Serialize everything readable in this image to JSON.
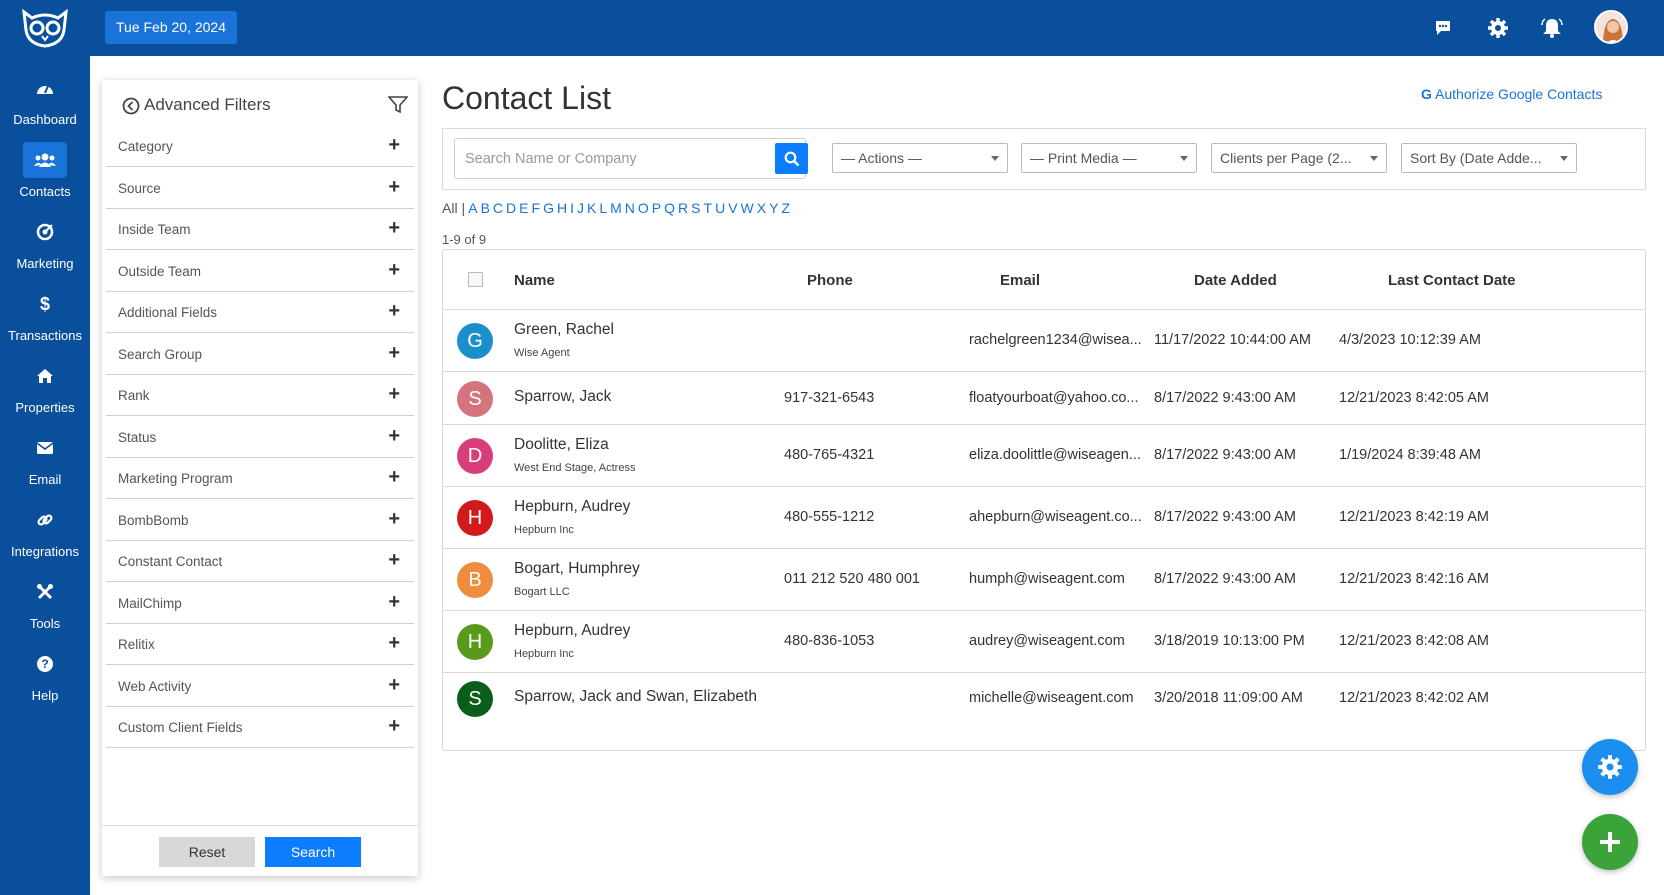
{
  "header": {
    "date": "Tue Feb 20, 2024",
    "icons": [
      "chat-icon",
      "gear-icon",
      "bell-icon",
      "avatar"
    ]
  },
  "sidebar": {
    "items": [
      {
        "label": "Dashboard",
        "icon": "speedometer-icon"
      },
      {
        "label": "Contacts",
        "icon": "users-icon",
        "active": true
      },
      {
        "label": "Marketing",
        "icon": "target-icon"
      },
      {
        "label": "Transactions",
        "icon": "dollar-icon"
      },
      {
        "label": "Properties",
        "icon": "home-icon"
      },
      {
        "label": "Email",
        "icon": "envelope-icon"
      },
      {
        "label": "Integrations",
        "icon": "link-icon"
      },
      {
        "label": "Tools",
        "icon": "tools-icon"
      },
      {
        "label": "Help",
        "icon": "question-icon"
      }
    ]
  },
  "filters": {
    "title": "Advanced Filters",
    "items": [
      "Category",
      "Source",
      "Inside Team",
      "Outside Team",
      "Additional Fields",
      "Search Group",
      "Rank",
      "Status",
      "Marketing Program",
      "BombBomb",
      "Constant Contact",
      "MailChimp",
      "Relitix",
      "Web Activity",
      "Custom Client Fields"
    ],
    "reset_label": "Reset",
    "search_label": "Search"
  },
  "main": {
    "title": "Contact List",
    "google_link": "Authorize Google Contacts",
    "search_placeholder": "Search Name or Company",
    "dropdowns": [
      "— Actions —",
      "— Print Media —",
      "Clients per Page (2...",
      "Sort By (Date Adde..."
    ],
    "alpha_all": "All",
    "alpha_letters": [
      "A",
      "B",
      "C",
      "D",
      "E",
      "F",
      "G",
      "H",
      "I",
      "J",
      "K",
      "L",
      "M",
      "N",
      "O",
      "P",
      "Q",
      "R",
      "S",
      "T",
      "U",
      "V",
      "W",
      "X",
      "Y",
      "Z"
    ],
    "count": "1-9 of 9",
    "columns": [
      "Name",
      "Phone",
      "Email",
      "Date Added",
      "Last Contact Date"
    ],
    "rows": [
      {
        "initial": "G",
        "color": "#1a8fc9",
        "name": "Green, Rachel",
        "sub": "Wise Agent",
        "phone": "",
        "email": "rachelgreen1234@wisea...",
        "added": "11/17/2022 10:44:00 AM",
        "last": "4/3/2023 10:12:39 AM"
      },
      {
        "initial": "S",
        "color": "#d3747e",
        "name": "Sparrow, Jack",
        "sub": "",
        "phone": "917-321-6543",
        "email": "floatyourboat@yahoo.co...",
        "added": "8/17/2022 9:43:00 AM",
        "last": "12/21/2023 8:42:05 AM"
      },
      {
        "initial": "D",
        "color": "#d83f7a",
        "name": "Doolitte, Eliza",
        "sub": "West End Stage, Actress",
        "phone": "480-765-4321",
        "email": "eliza.doolittle@wiseagen...",
        "added": "8/17/2022 9:43:00 AM",
        "last": "1/19/2024 8:39:48 AM"
      },
      {
        "initial": "H",
        "color": "#d11b1b",
        "name": "Hepburn, Audrey",
        "sub": "Hepburn Inc",
        "phone": "480-555-1212",
        "email": "ahepburn@wiseagent.co...",
        "added": "8/17/2022 9:43:00 AM",
        "last": "12/21/2023 8:42:19 AM"
      },
      {
        "initial": "B",
        "color": "#f08c3e",
        "name": "Bogart, Humphrey",
        "sub": "Bogart LLC",
        "phone": "011 212 520 480 001",
        "email": "humph@wiseagent.com",
        "added": "8/17/2022 9:43:00 AM",
        "last": "12/21/2023 8:42:16 AM"
      },
      {
        "initial": "H",
        "color": "#5a9a1a",
        "name": "Hepburn, Audrey",
        "sub": "Hepburn Inc",
        "phone": "480-836-1053",
        "email": "audrey@wiseagent.com",
        "added": "3/18/2019 10:13:00 PM",
        "last": "12/21/2023 8:42:08 AM"
      },
      {
        "initial": "S",
        "color": "#0b5e1a",
        "name": "Sparrow, Jack and Swan, Elizabeth",
        "sub": "",
        "phone": "",
        "email": "michelle@wiseagent.com",
        "added": "3/20/2018 11:09:00 AM",
        "last": "12/21/2023 8:42:02 AM"
      }
    ]
  },
  "fabs": [
    {
      "icon": "gear-icon",
      "color": "#1a8ff0"
    },
    {
      "icon": "plus-icon",
      "color": "#3aa33a"
    }
  ]
}
